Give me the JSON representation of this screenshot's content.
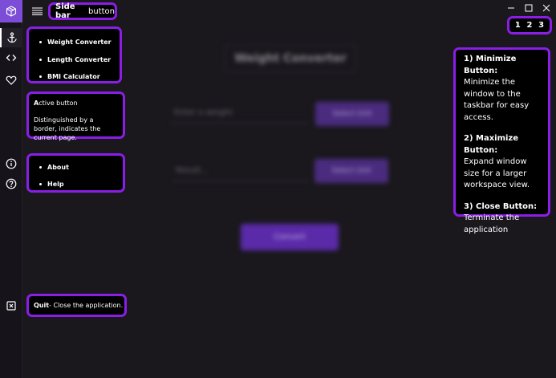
{
  "topbar": {
    "sidebar_button_label_bold": "Side bar",
    "sidebar_button_label_rest": "button",
    "window_numbers": [
      "1",
      "2",
      "3"
    ]
  },
  "nav_menu": [
    "Weight Converter",
    "Length Converter",
    "BMI Calculator"
  ],
  "active_button": {
    "title_bold": "A",
    "title_rest": "ctive button",
    "description": "Distinguished by a border, indicates the current page."
  },
  "info_menu": [
    "About",
    "Help"
  ],
  "quit": {
    "bold": "Quit",
    "rest": " - Close the application."
  },
  "main": {
    "title": "Weight Converter",
    "input_placeholder": "Enter a weight",
    "select1": "Select Unit",
    "result_placeholder": "Result...",
    "select2": "Select Unit",
    "convert_label": "Convert"
  },
  "window_info": [
    {
      "heading": "1) Minimize Button:",
      "text": "Minimize the window to the taskbar for easy access."
    },
    {
      "heading": "2) Maximize Button:",
      "text": "Expand window size for a larger workspace view."
    },
    {
      "heading": "3) Close Button:",
      "text": "Terminate the application"
    }
  ],
  "colors": {
    "accent": "#8a1ee6",
    "logo": "#7c4dd6",
    "background": "#1a181d"
  },
  "icons": [
    "app-logo-icon",
    "hamburger-icon",
    "anchor-icon",
    "code-icon",
    "heart-icon",
    "info-icon",
    "help-icon",
    "quit-icon",
    "minimize-icon",
    "maximize-icon",
    "close-icon"
  ]
}
